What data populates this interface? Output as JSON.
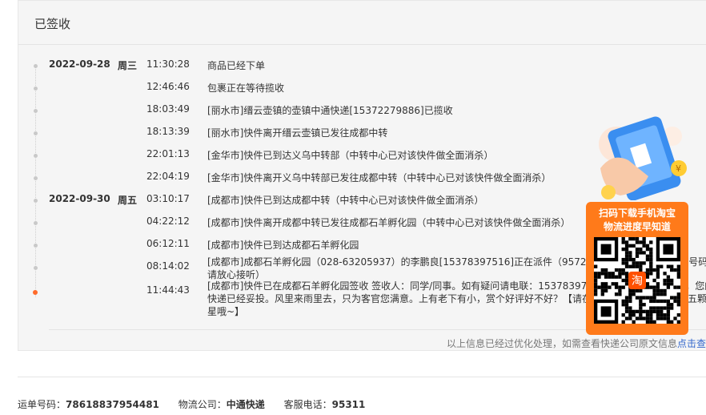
{
  "panel": {
    "title": "已签收"
  },
  "timeline": [
    {
      "date": "2022-09-28",
      "weekday": "周三",
      "time": "11:30:28",
      "desc": "商品已经下单"
    },
    {
      "date": "",
      "weekday": "",
      "time": "12:46:46",
      "desc": "包裹正在等待揽收"
    },
    {
      "date": "",
      "weekday": "",
      "time": "18:03:49",
      "desc": "[丽水市]缙云壶镇的壶镇中通快递[15372279886]已揽收"
    },
    {
      "date": "",
      "weekday": "",
      "time": "18:13:39",
      "desc": "[丽水市]快件离开缙云壶镇已发往成都中转"
    },
    {
      "date": "",
      "weekday": "",
      "time": "22:01:13",
      "desc": "[金华市]快件已到达义乌中转部（中转中心已对该快件做全面消杀）"
    },
    {
      "date": "",
      "weekday": "",
      "time": "22:04:19",
      "desc": "[金华市]快件离开义乌中转部已发往成都中转（中转中心已对该快件做全面消杀）"
    },
    {
      "date": "2022-09-30",
      "weekday": "周五",
      "time": "03:10:17",
      "desc": "[成都市]快件已到达成都中转（中转中心已对该快件做全面消杀）"
    },
    {
      "date": "",
      "weekday": "",
      "time": "04:22:12",
      "desc": "[成都市]快件离开成都中转已发往成都石羊孵化园（中转中心已对该快件做全面消杀）"
    },
    {
      "date": "",
      "weekday": "",
      "time": "06:12:11",
      "desc": "[成都市]快件已到达成都石羊孵化园"
    },
    {
      "date": "",
      "weekday": "",
      "time": "08:14:02",
      "desc": "[成都市]成都石羊孵化园（028-63205937）的李鹏良[15378397516]正在派件（95720为中通快递员外呼专属号码，请放心接听）"
    },
    {
      "date": "",
      "weekday": "",
      "time": "11:44:43",
      "desc": "[成都市]快件已在成都石羊孵化园签收 签收人：同学/同事。如有疑问请电联：15378397516 / 028-63205937，您的快递已经妥投。风里来雨里去，只为客官您满意。上有老下有小，赏个好评好不好？【请在评价快递员处帮忙点亮五颗星星哦~】"
    }
  ],
  "note": {
    "text": "以上信息已经过优化处理，如需查看快递公司原文信息",
    "link": "点击查看"
  },
  "footer": {
    "waybill_label": "运单号码：",
    "waybill": "78618837954481",
    "company_label": "物流公司：",
    "company": "中通快递",
    "phone_label": "客服电话：",
    "phone": "95311"
  },
  "promo": {
    "line1": "扫码下载手机淘宝",
    "line2": "物流进度早知道",
    "qr_badge": "淘"
  },
  "colors": {
    "accent": "#ff7a1a",
    "current_dot": "#ff6a2a",
    "link": "#3366cc"
  }
}
